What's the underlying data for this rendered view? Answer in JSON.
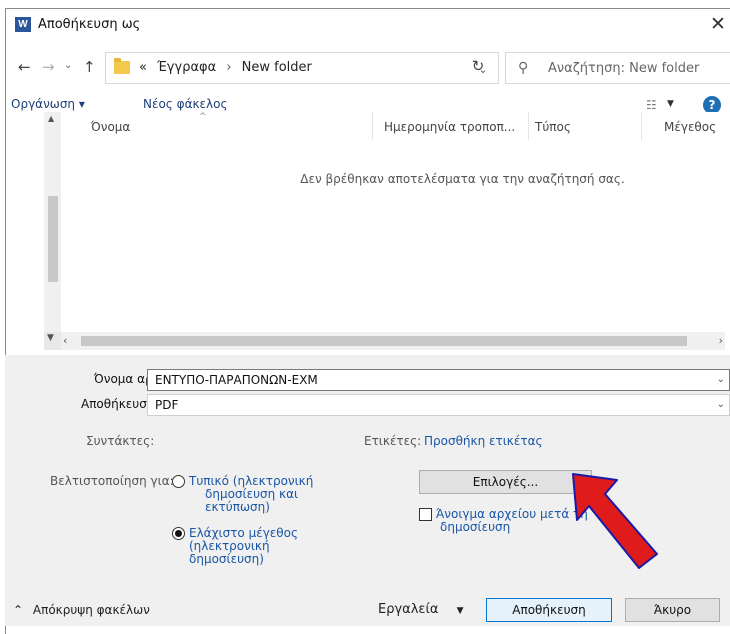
{
  "window": {
    "title": "Αποθήκευση ως",
    "app_icon_letter": "W"
  },
  "nav": {
    "crumbs": [
      "«",
      "Έγγραφα",
      "New folder"
    ],
    "search_placeholder": "Αναζήτηση: New folder"
  },
  "commandbar": {
    "organize": "Οργάνωση ▾",
    "new_folder": "Νέος φάκελος"
  },
  "files": {
    "columns": [
      "Όνομα",
      "Ημερομηνία τροποπ...",
      "Τύπος",
      "Μέγεθος"
    ],
    "empty_message": "Δεν βρέθηκαν αποτελέσματα για την αναζήτησή σας."
  },
  "form": {
    "filename_label": "Όνομα αρχείου:",
    "filename_value": "ΕΝΤΥΠΟ-ΠΑΡΑΠΟΝΩΝ-ΕΧΜ",
    "savetype_label": "Αποθήκευση ως:",
    "savetype_value": "PDF",
    "authors_label": "Συντάκτες:",
    "tags_label": "Ετικέτες:",
    "tags_link": "Προσθήκη ετικέτας",
    "optimize_label": "Βελτιστοποίηση για:",
    "opt_standard_lines": [
      "Τυπικό (ηλεκτρονική",
      "δημοσίευση και",
      "εκτύπωση)"
    ],
    "opt_minimum_lines": [
      "Ελάχιστο μέγεθος",
      "(ηλεκτρονική",
      "δημοσίευση)"
    ],
    "options_button": "Επιλογές...",
    "open_after_lines": [
      "Άνοιγμα αρχείου μετά τη",
      "δημοσίευση"
    ]
  },
  "footer": {
    "hide_folders": "Απόκρυψη φακέλων",
    "tools": "Εργαλεία",
    "save": "Αποθήκευση",
    "cancel": "Άκυρο"
  },
  "colors": {
    "accent": "#1b56a5",
    "arrow": "#e01b1b",
    "arrow_outline": "#1a1aa8"
  }
}
